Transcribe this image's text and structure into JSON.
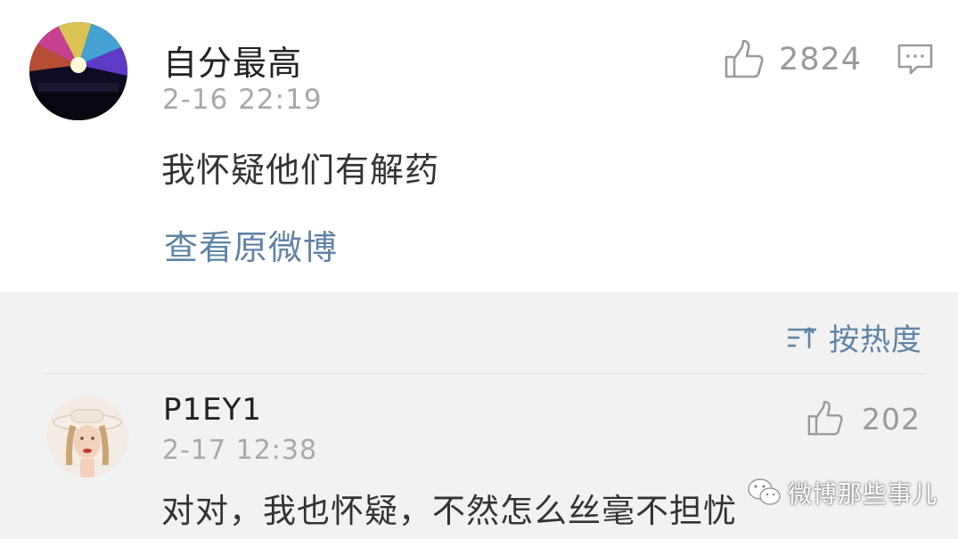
{
  "post": {
    "author": "自分最高",
    "time": "2-16 22:19",
    "text": "我怀疑他们有解药",
    "view_original_label": "查看原微博",
    "like_count": "2824",
    "icons": {
      "like": "thumbs-up-icon",
      "comment": "comment-icon"
    }
  },
  "comments": {
    "sort_label": "按热度",
    "sort_icon": "sort-icon",
    "items": [
      {
        "author": "P1EY1",
        "time": "2-17 12:38",
        "text": "对对，我也怀疑，不然怎么丝毫不担忧",
        "like_count": "202"
      }
    ]
  },
  "watermark": {
    "text": "微博那些事儿",
    "icon": "wechat-logo-icon"
  },
  "colors": {
    "link": "#5f84a6",
    "muted": "#a9a9a9",
    "comments_bg": "#f2f2f2"
  }
}
